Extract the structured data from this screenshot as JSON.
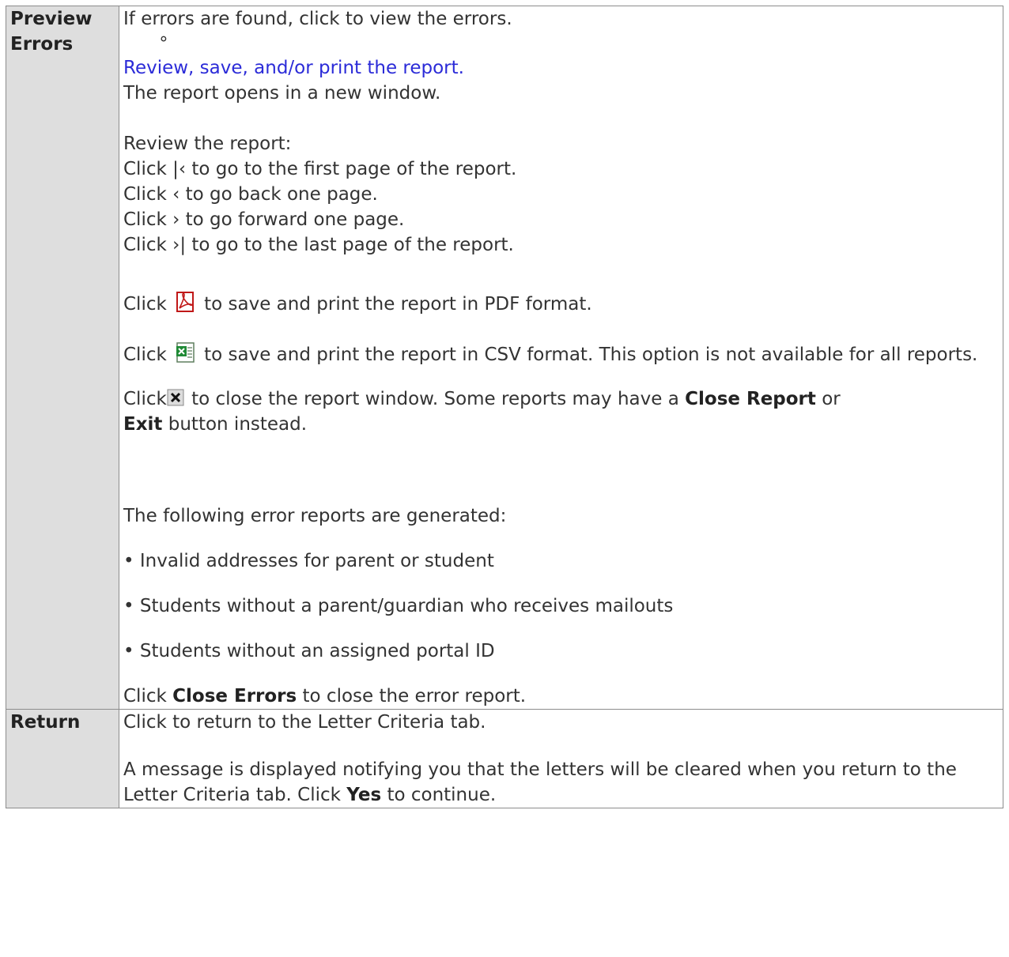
{
  "rows": [
    {
      "header_line1": "Preview",
      "header_line2": "Errors",
      "intro": "If errors are found, click to view the errors.",
      "sub_bullet": "∘",
      "review_link": "Review, save, and/or print the report.",
      "opens_text": "The report opens in a new window.",
      "review_heading": "Review the report:",
      "nav_first": "Click |‹ to go to the first page of the report.",
      "nav_back": "Click ‹ to go back one page.",
      "nav_forward": "Click › to go forward one page.",
      "nav_last": "Click ›| to go to the last page of the report.",
      "click_word": "Click",
      "pdf_text": "to save and print the report in PDF format.",
      "csv_text": "to save and print the report in CSV format. This option is not available for all reports.",
      "close_text_before": "to close the report window. Some reports may have a",
      "close_report_bold": "Close Report",
      "close_or": "or",
      "exit_bold": "Exit",
      "close_text_after": "button instead.",
      "error_reports_intro": "The following error reports are generated:",
      "error_items": [
        "• Invalid addresses for parent or student",
        "• Students without a parent/guardian who receives mailouts",
        "• Students without an assigned portal ID"
      ],
      "close_errors_before": "Click",
      "close_errors_bold": "Close Errors",
      "close_errors_after": "to close the error report."
    },
    {
      "header_line1": "Return",
      "return_text": "Click to return to the Letter Criteria tab.",
      "message_before": "A message is displayed notifying you that the letters will be cleared when you return to the Letter Criteria tab. Click",
      "yes_bold": "Yes",
      "message_after": "to continue."
    }
  ],
  "icons": {
    "pdf": "pdf-icon",
    "csv": "excel-icon",
    "close": "close-x-icon"
  }
}
